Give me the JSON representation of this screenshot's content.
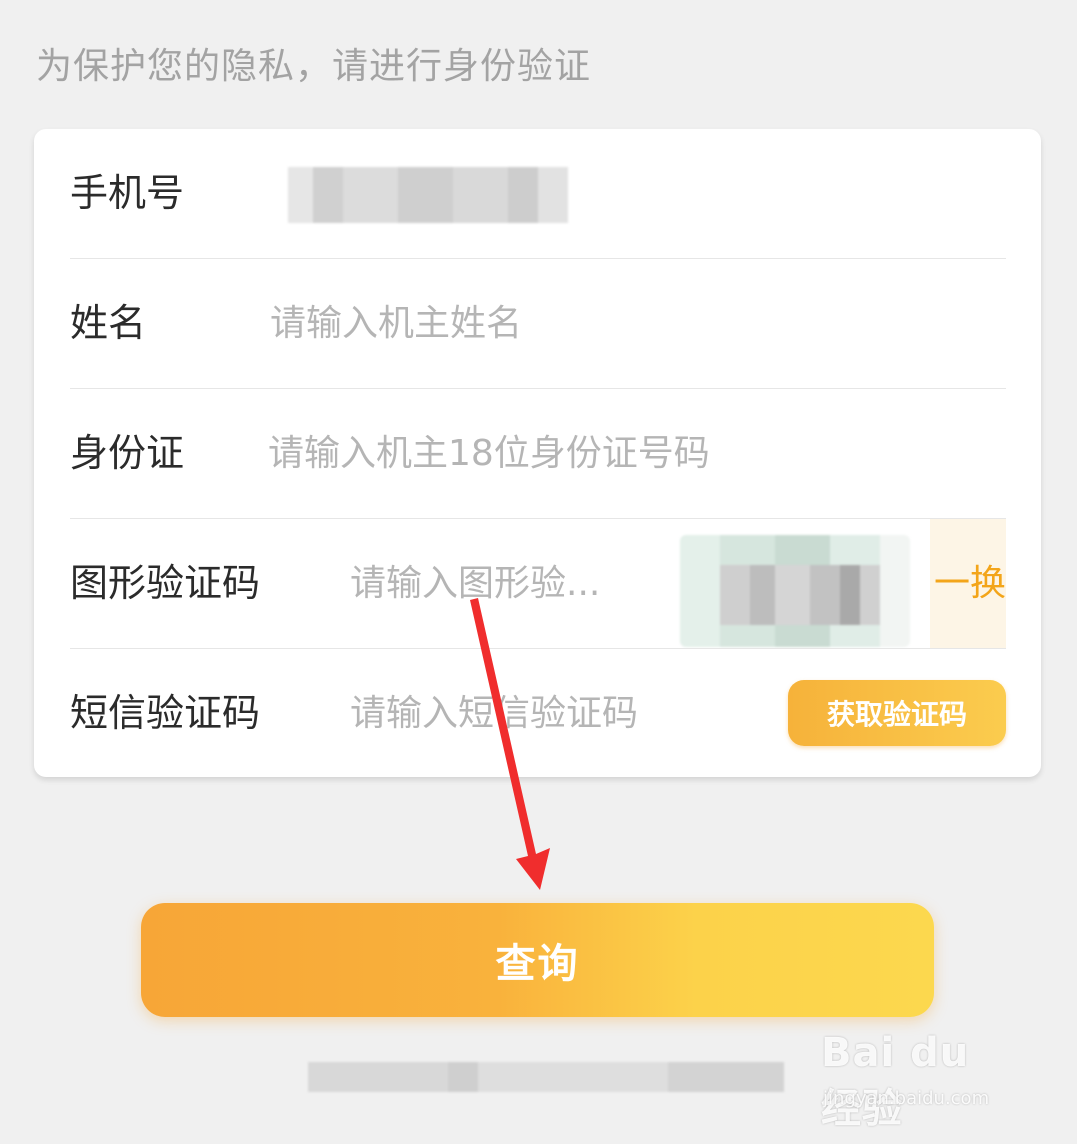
{
  "header": {
    "subtitle": "为保护您的隐私，请进行身份验证"
  },
  "form": {
    "phone": {
      "label": "手机号"
    },
    "name": {
      "label": "姓名",
      "placeholder": "请输入机主姓名"
    },
    "id_card": {
      "label": "身份证",
      "placeholder": "请输入机主18位身份证号码"
    },
    "captcha": {
      "label": "图形验证码",
      "placeholder": "请输入图形验...",
      "refresh_label": "一换"
    },
    "sms": {
      "label": "短信验证码",
      "placeholder": "请输入短信验证码",
      "button_label": "获取验证码"
    }
  },
  "actions": {
    "query_label": "查询"
  },
  "watermark": {
    "logo": "Bai du 经验",
    "url": "jingyan.baidu.com"
  },
  "colors": {
    "accent": "#f3a51a",
    "button_start": "#f7a637",
    "button_end": "#fcd84e",
    "arrow": "#f02d2d"
  }
}
